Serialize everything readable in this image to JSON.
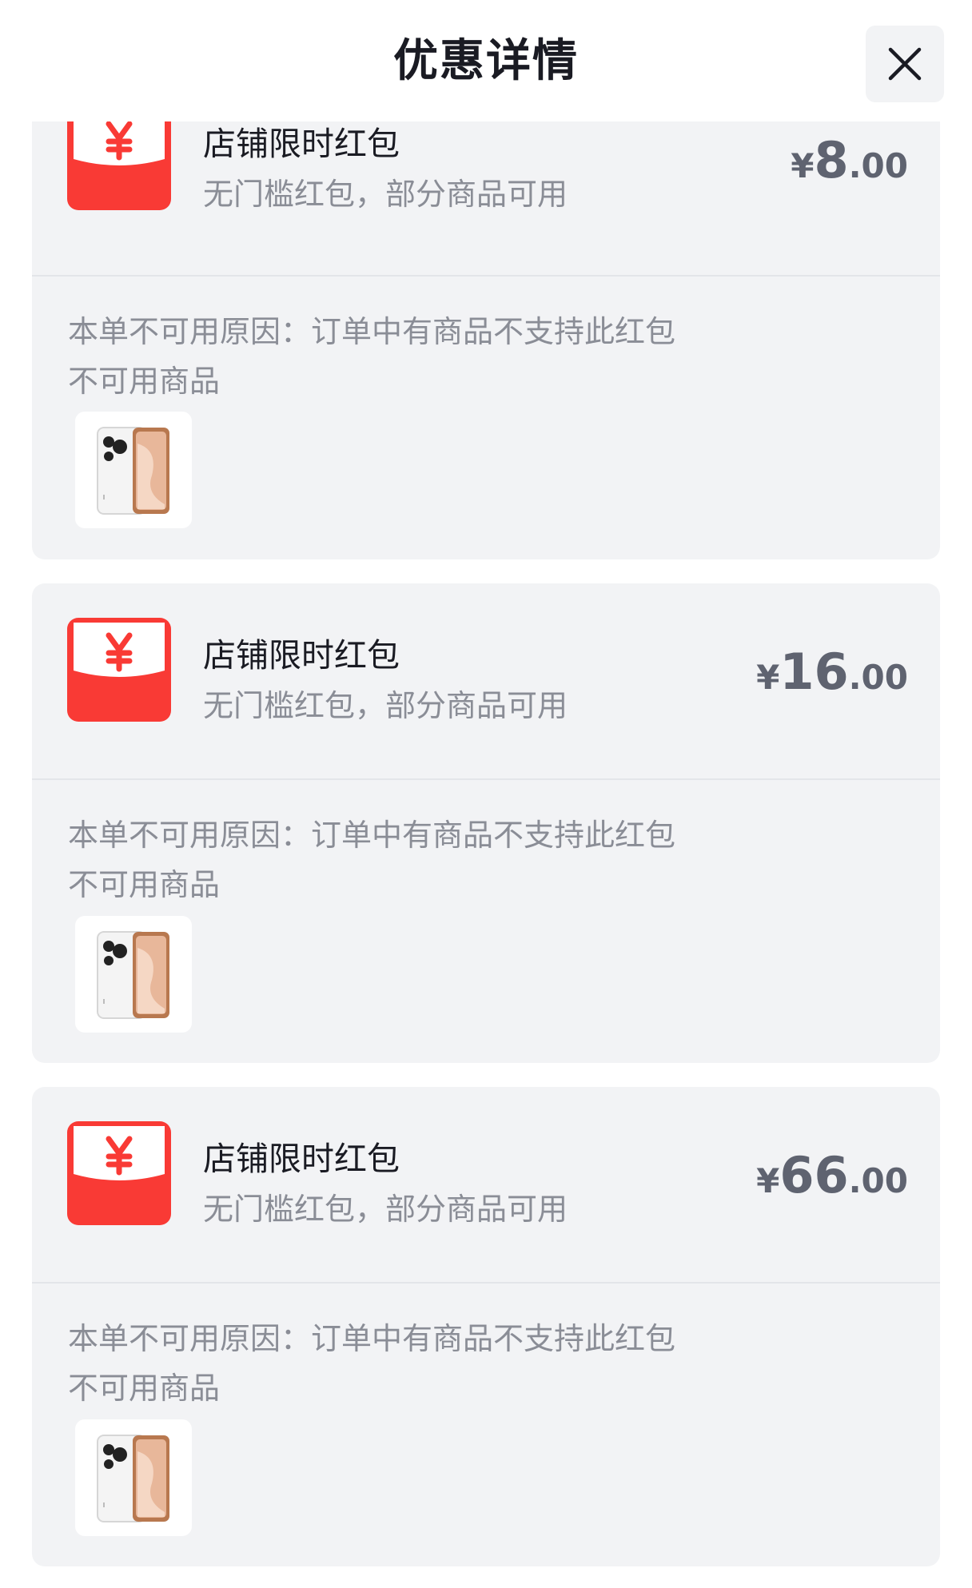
{
  "header": {
    "title": "优惠详情",
    "close_icon": "close-icon"
  },
  "colors": {
    "red_packet": "#f93a35",
    "text_primary": "#1a1b23",
    "text_secondary": "#8a8d96",
    "amount": "#5f6370",
    "card_bg": "#f2f3f5"
  },
  "coupons": [
    {
      "name": "店铺限时红包",
      "description": "无门槛红包，部分商品可用",
      "amount_currency": "¥",
      "amount_integer": "8",
      "amount_decimal": ".00",
      "reason": "本单不可用原因：订单中有商品不支持此红包",
      "unusable_label": "不可用商品",
      "icon": "red-packet-icon",
      "product_image": "white-phone"
    },
    {
      "name": "店铺限时红包",
      "description": "无门槛红包，部分商品可用",
      "amount_currency": "¥",
      "amount_integer": "16",
      "amount_decimal": ".00",
      "reason": "本单不可用原因：订单中有商品不支持此红包",
      "unusable_label": "不可用商品",
      "icon": "red-packet-icon",
      "product_image": "white-phone"
    },
    {
      "name": "店铺限时红包",
      "description": "无门槛红包，部分商品可用",
      "amount_currency": "¥",
      "amount_integer": "66",
      "amount_decimal": ".00",
      "reason": "本单不可用原因：订单中有商品不支持此红包",
      "unusable_label": "不可用商品",
      "icon": "red-packet-icon",
      "product_image": "white-phone"
    }
  ]
}
